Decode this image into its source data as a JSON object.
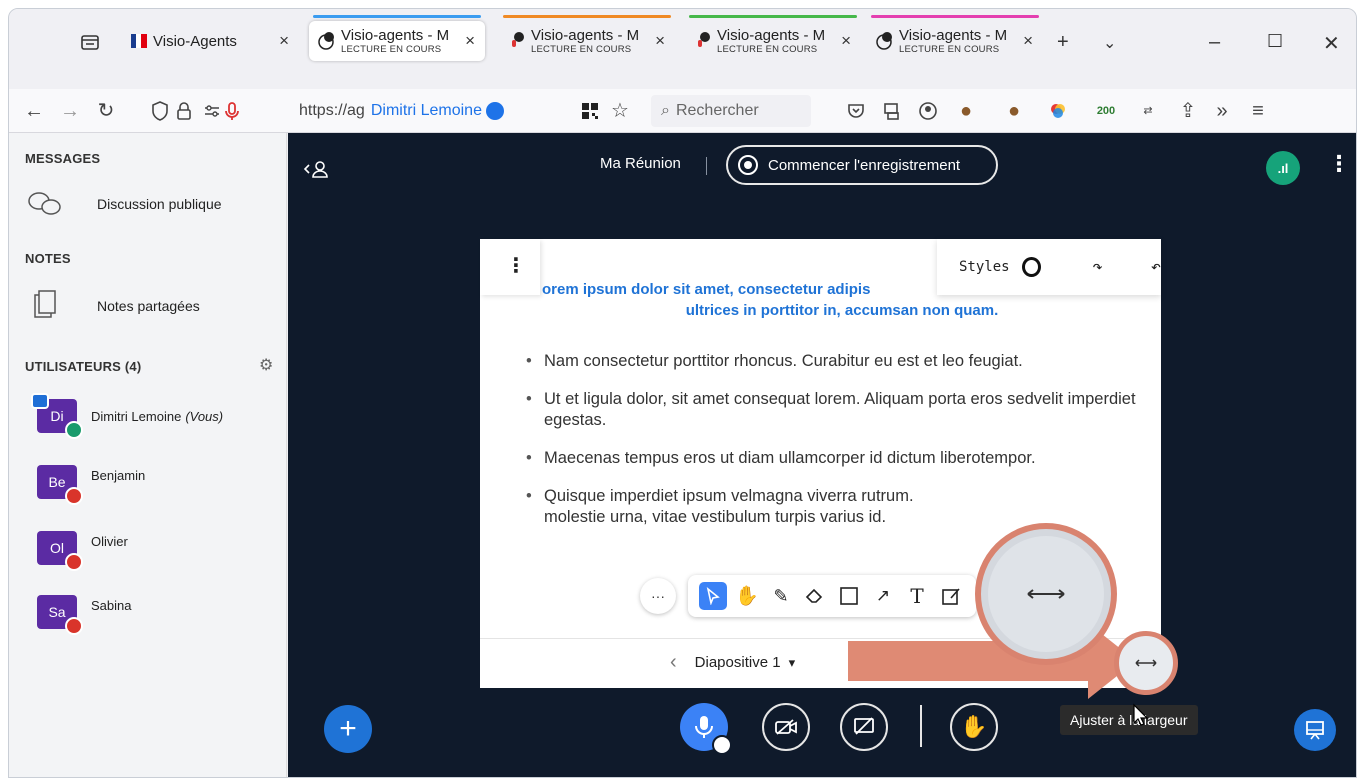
{
  "browser": {
    "tabs": [
      {
        "title": "Visio-Agents",
        "subtitle": "",
        "active": false,
        "accent": ""
      },
      {
        "title": "Visio-agents - M",
        "subtitle": "LECTURE EN COURS",
        "active": true,
        "accent": "#3b9cf0"
      },
      {
        "title": "Visio-agents - M",
        "subtitle": "LECTURE EN COURS",
        "active": false,
        "accent": "#f08a24"
      },
      {
        "title": "Visio-agents - M",
        "subtitle": "LECTURE EN COURS",
        "active": false,
        "accent": "#46b84a"
      },
      {
        "title": "Visio-agents - M",
        "subtitle": "LECTURE EN COURS",
        "active": false,
        "accent": "#e43fb0"
      }
    ],
    "url_text": "https://ag",
    "url_user": "Dimitri Lemoine",
    "search_placeholder": "Rechercher",
    "counter_badge": "200"
  },
  "sidebar": {
    "messages_heading": "MESSAGES",
    "public_chat": "Discussion publique",
    "notes_heading": "NOTES",
    "shared_notes": "Notes partagées",
    "users_heading": "UTILISATEURS (4)",
    "users": [
      {
        "initials": "Di",
        "name": "Dimitri Lemoine",
        "suffix": "(Vous)",
        "color": "#5b2ba3"
      },
      {
        "initials": "Be",
        "name": "Benjamin",
        "suffix": "",
        "color": "#5b2ba3"
      },
      {
        "initials": "Ol",
        "name": "Olivier",
        "suffix": "",
        "color": "#5b2ba3"
      },
      {
        "initials": "Sa",
        "name": "Sabina",
        "suffix": "",
        "color": "#5b2ba3"
      }
    ]
  },
  "meeting": {
    "title": "Ma Réunion",
    "record_label": "Commencer l'enregistrement"
  },
  "slide": {
    "title_line1": "orem ipsum dolor sit amet, consectetur adipis",
    "title_line2": "ultrices in porttitor in, accumsan non quam.",
    "bullets": [
      "Nam consectetur porttitor rhoncus. Curabitur eu est et leo feugiat.",
      "Ut et ligula dolor, sit amet consequat lorem. Aliquam porta eros sedvelit imperdiet egestas.",
      "Maecenas tempus eros ut diam ullamcorper id dictum liberotempor.",
      "Quisque imperdiet ipsum velmagna viverra rutrum. molestie urna, vitae vestibulum turpis varius id."
    ],
    "styles_label": "Styles",
    "page_label": "Diapositive 1"
  },
  "tooltip": "Ajuster à la largeur",
  "colors": {
    "accent": "#1f73d6",
    "highlight": "#d9836f",
    "main_bg": "#0f1a2b"
  }
}
